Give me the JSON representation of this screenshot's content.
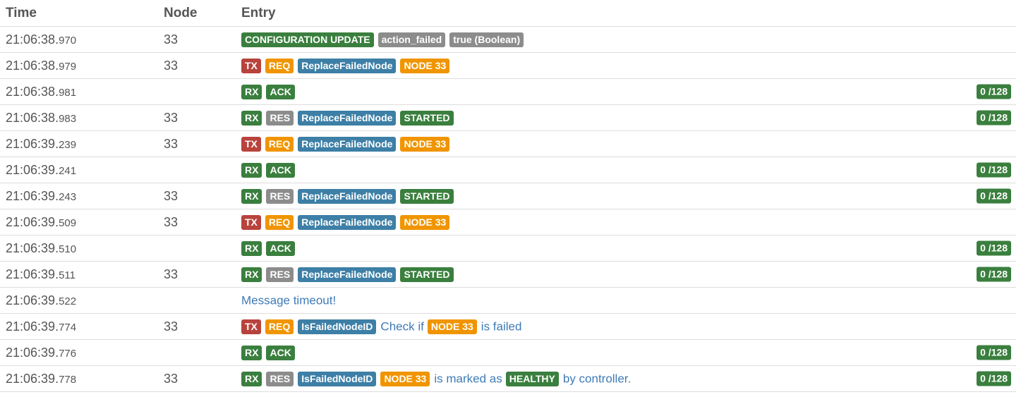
{
  "headers": {
    "time": "Time",
    "node": "Node",
    "entry": "Entry"
  },
  "rows": [
    {
      "time": "21:06:38.",
      "ms": "970",
      "node": "33",
      "parts": [
        {
          "t": "label",
          "c": "green",
          "v": "CONFIGURATION UPDATE"
        },
        {
          "t": "label",
          "c": "gray",
          "v": "action_failed"
        },
        {
          "t": "label",
          "c": "gray",
          "v": "true (Boolean)"
        }
      ],
      "counter": ""
    },
    {
      "time": "21:06:38.",
      "ms": "979",
      "node": "33",
      "parts": [
        {
          "t": "label",
          "c": "red",
          "v": "TX"
        },
        {
          "t": "label",
          "c": "orange",
          "v": "REQ"
        },
        {
          "t": "label",
          "c": "blue",
          "v": "ReplaceFailedNode"
        },
        {
          "t": "label",
          "c": "orange",
          "v": "NODE 33"
        }
      ],
      "counter": ""
    },
    {
      "time": "21:06:38.",
      "ms": "981",
      "node": "",
      "parts": [
        {
          "t": "label",
          "c": "green",
          "v": "RX"
        },
        {
          "t": "label",
          "c": "green",
          "v": "ACK"
        }
      ],
      "counter": "0 /128"
    },
    {
      "time": "21:06:38.",
      "ms": "983",
      "node": "33",
      "parts": [
        {
          "t": "label",
          "c": "green",
          "v": "RX"
        },
        {
          "t": "label",
          "c": "gray",
          "v": "RES"
        },
        {
          "t": "label",
          "c": "blue",
          "v": "ReplaceFailedNode"
        },
        {
          "t": "label",
          "c": "green",
          "v": "STARTED"
        }
      ],
      "counter": "0 /128"
    },
    {
      "time": "21:06:39.",
      "ms": "239",
      "node": "33",
      "parts": [
        {
          "t": "label",
          "c": "red",
          "v": "TX"
        },
        {
          "t": "label",
          "c": "orange",
          "v": "REQ"
        },
        {
          "t": "label",
          "c": "blue",
          "v": "ReplaceFailedNode"
        },
        {
          "t": "label",
          "c": "orange",
          "v": "NODE 33"
        }
      ],
      "counter": ""
    },
    {
      "time": "21:06:39.",
      "ms": "241",
      "node": "",
      "parts": [
        {
          "t": "label",
          "c": "green",
          "v": "RX"
        },
        {
          "t": "label",
          "c": "green",
          "v": "ACK"
        }
      ],
      "counter": "0 /128"
    },
    {
      "time": "21:06:39.",
      "ms": "243",
      "node": "33",
      "parts": [
        {
          "t": "label",
          "c": "green",
          "v": "RX"
        },
        {
          "t": "label",
          "c": "gray",
          "v": "RES"
        },
        {
          "t": "label",
          "c": "blue",
          "v": "ReplaceFailedNode"
        },
        {
          "t": "label",
          "c": "green",
          "v": "STARTED"
        }
      ],
      "counter": "0 /128"
    },
    {
      "time": "21:06:39.",
      "ms": "509",
      "node": "33",
      "parts": [
        {
          "t": "label",
          "c": "red",
          "v": "TX"
        },
        {
          "t": "label",
          "c": "orange",
          "v": "REQ"
        },
        {
          "t": "label",
          "c": "blue",
          "v": "ReplaceFailedNode"
        },
        {
          "t": "label",
          "c": "orange",
          "v": "NODE 33"
        }
      ],
      "counter": ""
    },
    {
      "time": "21:06:39.",
      "ms": "510",
      "node": "",
      "parts": [
        {
          "t": "label",
          "c": "green",
          "v": "RX"
        },
        {
          "t": "label",
          "c": "green",
          "v": "ACK"
        }
      ],
      "counter": "0 /128"
    },
    {
      "time": "21:06:39.",
      "ms": "511",
      "node": "33",
      "parts": [
        {
          "t": "label",
          "c": "green",
          "v": "RX"
        },
        {
          "t": "label",
          "c": "gray",
          "v": "RES"
        },
        {
          "t": "label",
          "c": "blue",
          "v": "ReplaceFailedNode"
        },
        {
          "t": "label",
          "c": "green",
          "v": "STARTED"
        }
      ],
      "counter": "0 /128"
    },
    {
      "time": "21:06:39.",
      "ms": "522",
      "node": "",
      "parts": [
        {
          "t": "text",
          "v": "Message timeout!"
        }
      ],
      "counter": ""
    },
    {
      "time": "21:06:39.",
      "ms": "774",
      "node": "33",
      "parts": [
        {
          "t": "label",
          "c": "red",
          "v": "TX"
        },
        {
          "t": "label",
          "c": "orange",
          "v": "REQ"
        },
        {
          "t": "label",
          "c": "blue",
          "v": "IsFailedNodeID"
        },
        {
          "t": "text",
          "v": "Check if"
        },
        {
          "t": "label",
          "c": "orange",
          "v": "NODE 33"
        },
        {
          "t": "text",
          "v": "is failed"
        }
      ],
      "counter": ""
    },
    {
      "time": "21:06:39.",
      "ms": "776",
      "node": "",
      "parts": [
        {
          "t": "label",
          "c": "green",
          "v": "RX"
        },
        {
          "t": "label",
          "c": "green",
          "v": "ACK"
        }
      ],
      "counter": "0 /128"
    },
    {
      "time": "21:06:39.",
      "ms": "778",
      "node": "33",
      "parts": [
        {
          "t": "label",
          "c": "green",
          "v": "RX"
        },
        {
          "t": "label",
          "c": "gray",
          "v": "RES"
        },
        {
          "t": "label",
          "c": "blue",
          "v": "IsFailedNodeID"
        },
        {
          "t": "label",
          "c": "orange",
          "v": "NODE 33"
        },
        {
          "t": "text",
          "v": "is marked as"
        },
        {
          "t": "label",
          "c": "green",
          "v": "HEALTHY"
        },
        {
          "t": "text",
          "v": "by controller."
        }
      ],
      "counter": "0 /128"
    }
  ],
  "colors": {
    "green": "#3a7f3e",
    "gray": "#8c8c8c",
    "red": "#b8433d",
    "orange": "#f09500",
    "blue": "#3d7fa6",
    "text": "#3e7bb6"
  }
}
